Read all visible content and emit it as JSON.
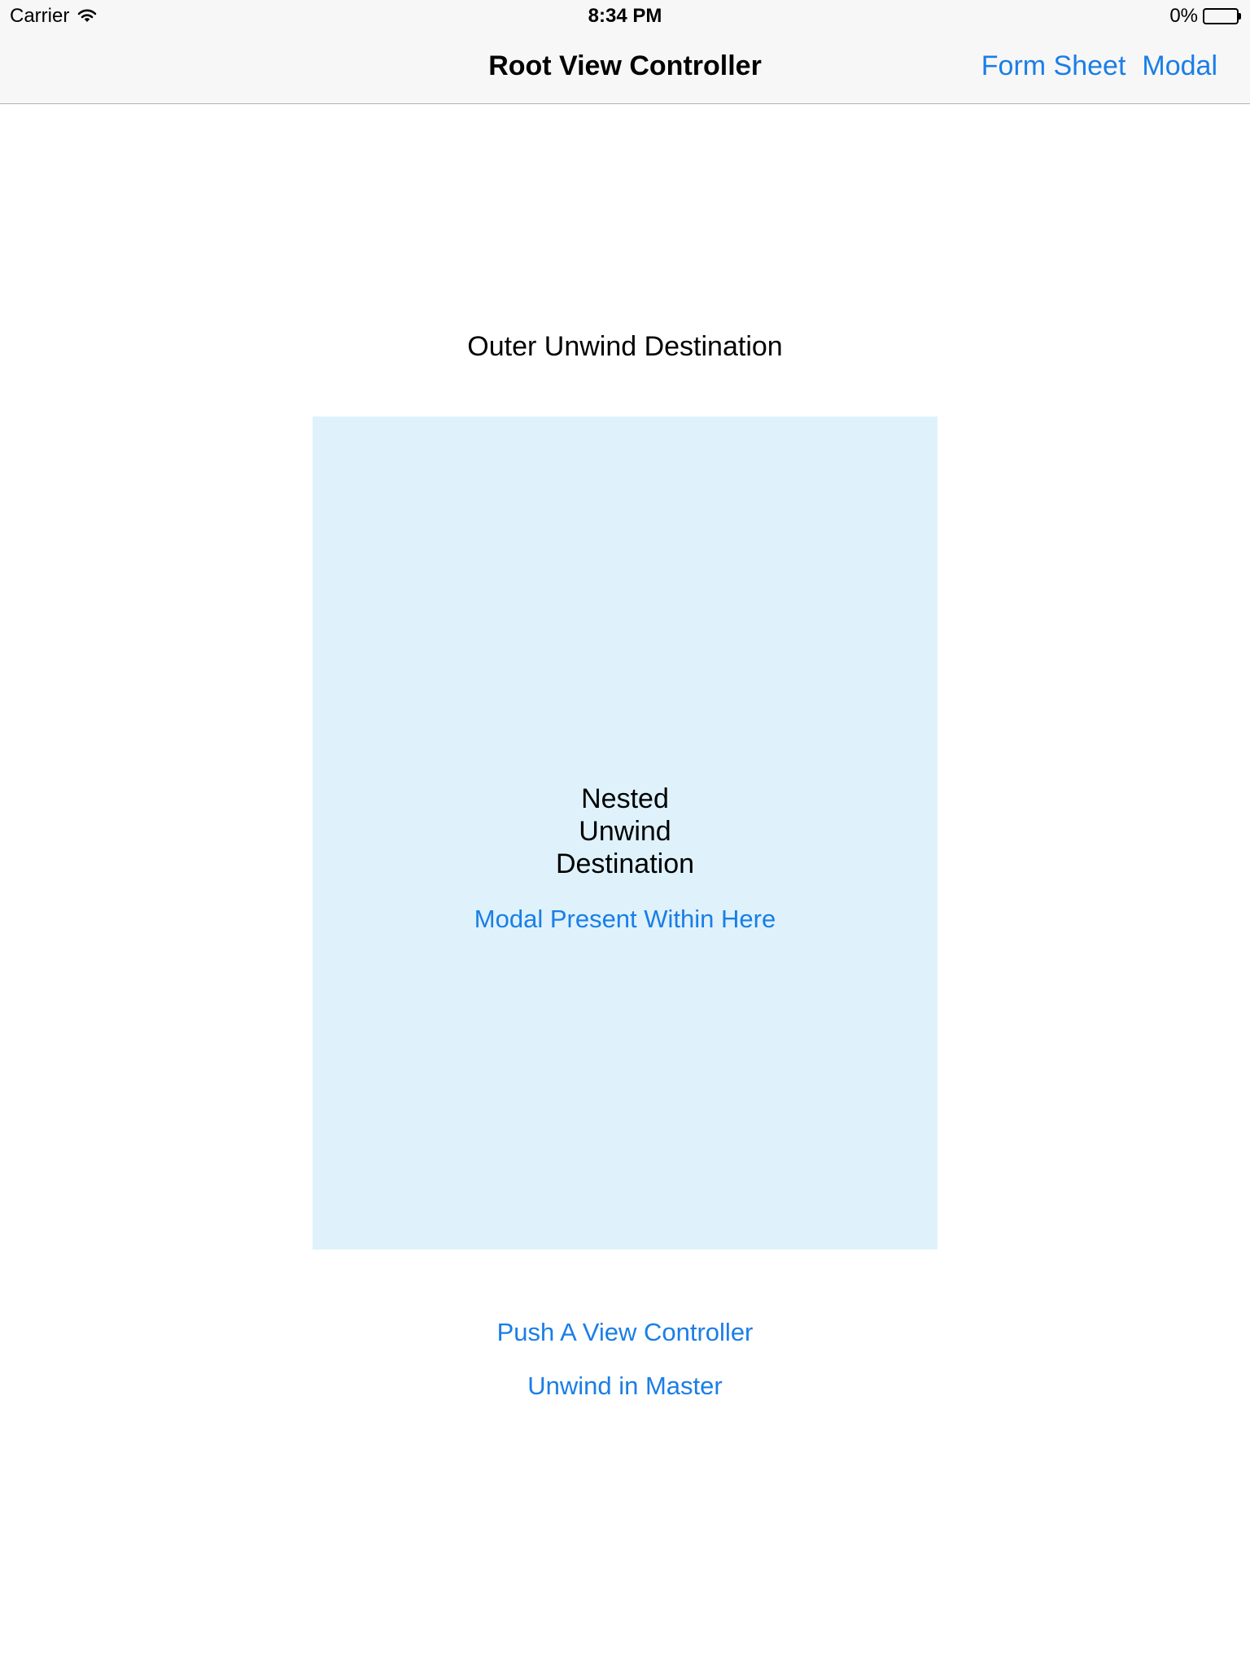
{
  "status_bar": {
    "carrier": "Carrier",
    "time": "8:34 PM",
    "battery": "0%"
  },
  "nav_bar": {
    "title": "Root View Controller",
    "form_sheet": "Form Sheet",
    "modal": "Modal"
  },
  "main": {
    "outer_label": "Outer Unwind Destination",
    "nested": {
      "label_lines": [
        "Nested",
        "Unwind",
        "Destination"
      ],
      "modal_link": "Modal Present Within Here"
    },
    "push_link": "Push A View Controller",
    "unwind_link": "Unwind in Master"
  },
  "colors": {
    "tint": "#1a7ee6",
    "bar_background": "#f7f7f7",
    "nested_background": "#dff2fc"
  },
  "icons": {
    "wifi": "wifi-icon",
    "battery": "battery-icon"
  }
}
